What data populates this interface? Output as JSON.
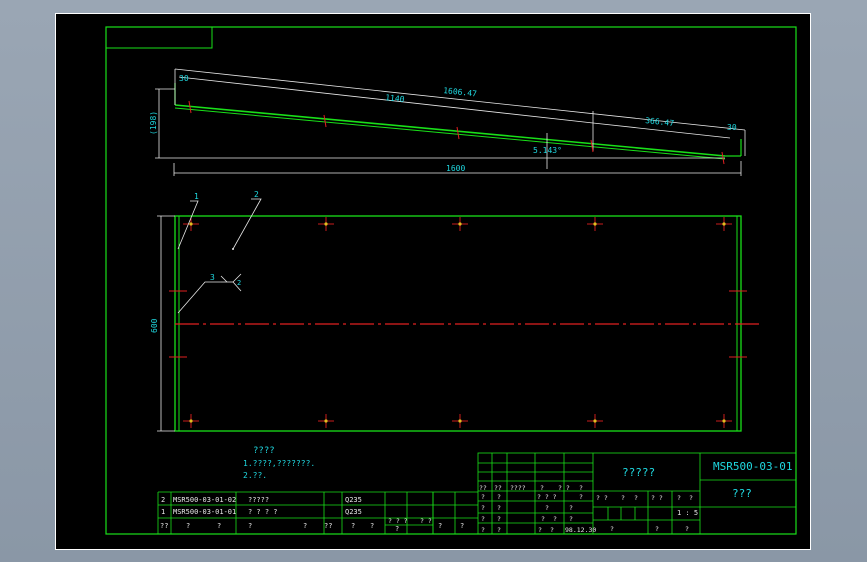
{
  "drawing": {
    "number": "MSR500-03-01",
    "title_name": "?????",
    "title_sub": "???",
    "scale": "1 : 5",
    "date": "98.12.30"
  },
  "side_view": {
    "dim_total_length": "1606.47",
    "dim_segment_1": "1140",
    "dim_segment_2": "366.47",
    "dim_left_end": "30",
    "dim_right_end": "30",
    "dim_height": "(198)",
    "dim_base": "1600",
    "dim_angle": "5.143°"
  },
  "plan_view": {
    "dim_width": "600",
    "callouts": [
      "1",
      "2",
      "3"
    ],
    "weld_note": "2"
  },
  "notes": {
    "heading": "????",
    "line1": "1.????,???????.",
    "line2": "2.??."
  },
  "parts_list": [
    {
      "no": "2",
      "code": "MSR500-03-01-02",
      "name": "?????",
      "material": "Q235"
    },
    {
      "no": "1",
      "code": "MSR500-03-01-01",
      "name": "? ? ? ?",
      "material": "Q235"
    }
  ],
  "parts_header": [
    "??",
    "?",
    "?",
    "?",
    "?",
    "??",
    "?",
    "?",
    "?",
    "?",
    "?"
  ],
  "title_block_cells": {
    "r1": [
      "??",
      "??",
      "????",
      "?",
      "? ?",
      "?"
    ],
    "r2": [
      "?",
      "?",
      "? ? ?",
      "?"
    ],
    "r3": [
      "?",
      "?",
      "?",
      "?"
    ],
    "r4": [
      "?",
      "?",
      "?",
      "?",
      "?"
    ],
    "r5": [
      "?",
      "?",
      "?",
      "?"
    ],
    "mid_r1": [
      "? ?",
      "?",
      "?",
      "? ?",
      "?",
      "?"
    ],
    "mid_r3": [
      "?",
      "?",
      "?"
    ]
  },
  "mid_text": [
    "? ? ?",
    "? ?",
    "?",
    "?"
  ]
}
